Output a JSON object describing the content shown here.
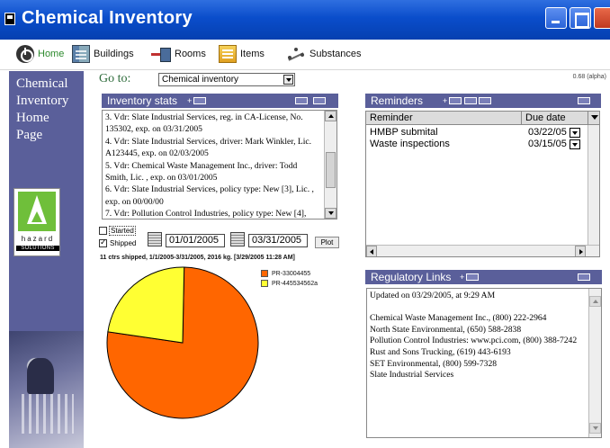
{
  "window": {
    "title": "Chemical Inventory"
  },
  "toolbar": {
    "home": "Home",
    "buildings": "Buildings",
    "rooms": "Rooms",
    "items": "Items",
    "substances": "Substances"
  },
  "sidebar": {
    "heading_lines": [
      "Chemical",
      "Inventory",
      "Home",
      "Page"
    ],
    "logo": {
      "name": "hazard",
      "sub": "SOLUTIONS"
    }
  },
  "goto": {
    "label": "Go to:",
    "selected": "Chemical inventory"
  },
  "version": "0.68 (alpha)",
  "inventory_stats": {
    "title": "Inventory stats",
    "lines": [
      "3. Vdr: Slate Industrial Services, reg. in CA-License, No. 135302, exp. on 03/31/2005",
      "4. Vdr: Slate Industrial Services, driver: Mark Winkler, Lic. A123445, exp. on 02/03/2005",
      "5. Vdr: Chemical Waste Management Inc., driver: Todd Smith, Lic. , exp. on 03/01/2005",
      "6. Vdr: Slate Industrial Services, policy type: New [3], Lic. , exp. on 00/00/00",
      "7. Vdr: Pollution Control Industries, policy type: New [4],"
    ]
  },
  "shipped_controls": {
    "started_label": "Started",
    "shipped_label": "Shipped",
    "started_checked": false,
    "shipped_checked": true,
    "from_date": "01/01/2005",
    "to_date": "03/31/2005",
    "plot_label": "Plot"
  },
  "ship_summary": "11 ctrs shipped, 1/1/2005-3/31/2005, 2016 kg. [3/29/2005 11:28 AM]",
  "chart_data": {
    "type": "pie",
    "series": [
      {
        "name": "PR-33004455",
        "value": 0.77,
        "color": "#ff6600"
      },
      {
        "name": "PR-445534562a",
        "value": 0.23,
        "color": "#ffff33"
      }
    ]
  },
  "reminders": {
    "title": "Reminders",
    "columns": [
      "Reminder",
      "Due date"
    ],
    "rows": [
      {
        "name": "HMBP submital",
        "date": "03/22/05"
      },
      {
        "name": "Waste inspections",
        "date": "03/15/05"
      }
    ]
  },
  "regulatory": {
    "title": "Regulatory Links",
    "updated": "Updated on 03/29/2005, at 9:29 AM",
    "lines": [
      "Chemical Waste Management Inc., (800) 222-2964",
      "North State Environmental, (650) 588-2838",
      "Pollution Control Industries: www.pci.com, (800) 388-7242",
      "Rust and Sons Trucking, (619) 443-6193",
      "SET Environmental, (800) 599-7328",
      "Slate Industrial Services"
    ]
  },
  "colors": {
    "brand": "#5a5f9a",
    "titlebar": "#0a4dcb"
  }
}
